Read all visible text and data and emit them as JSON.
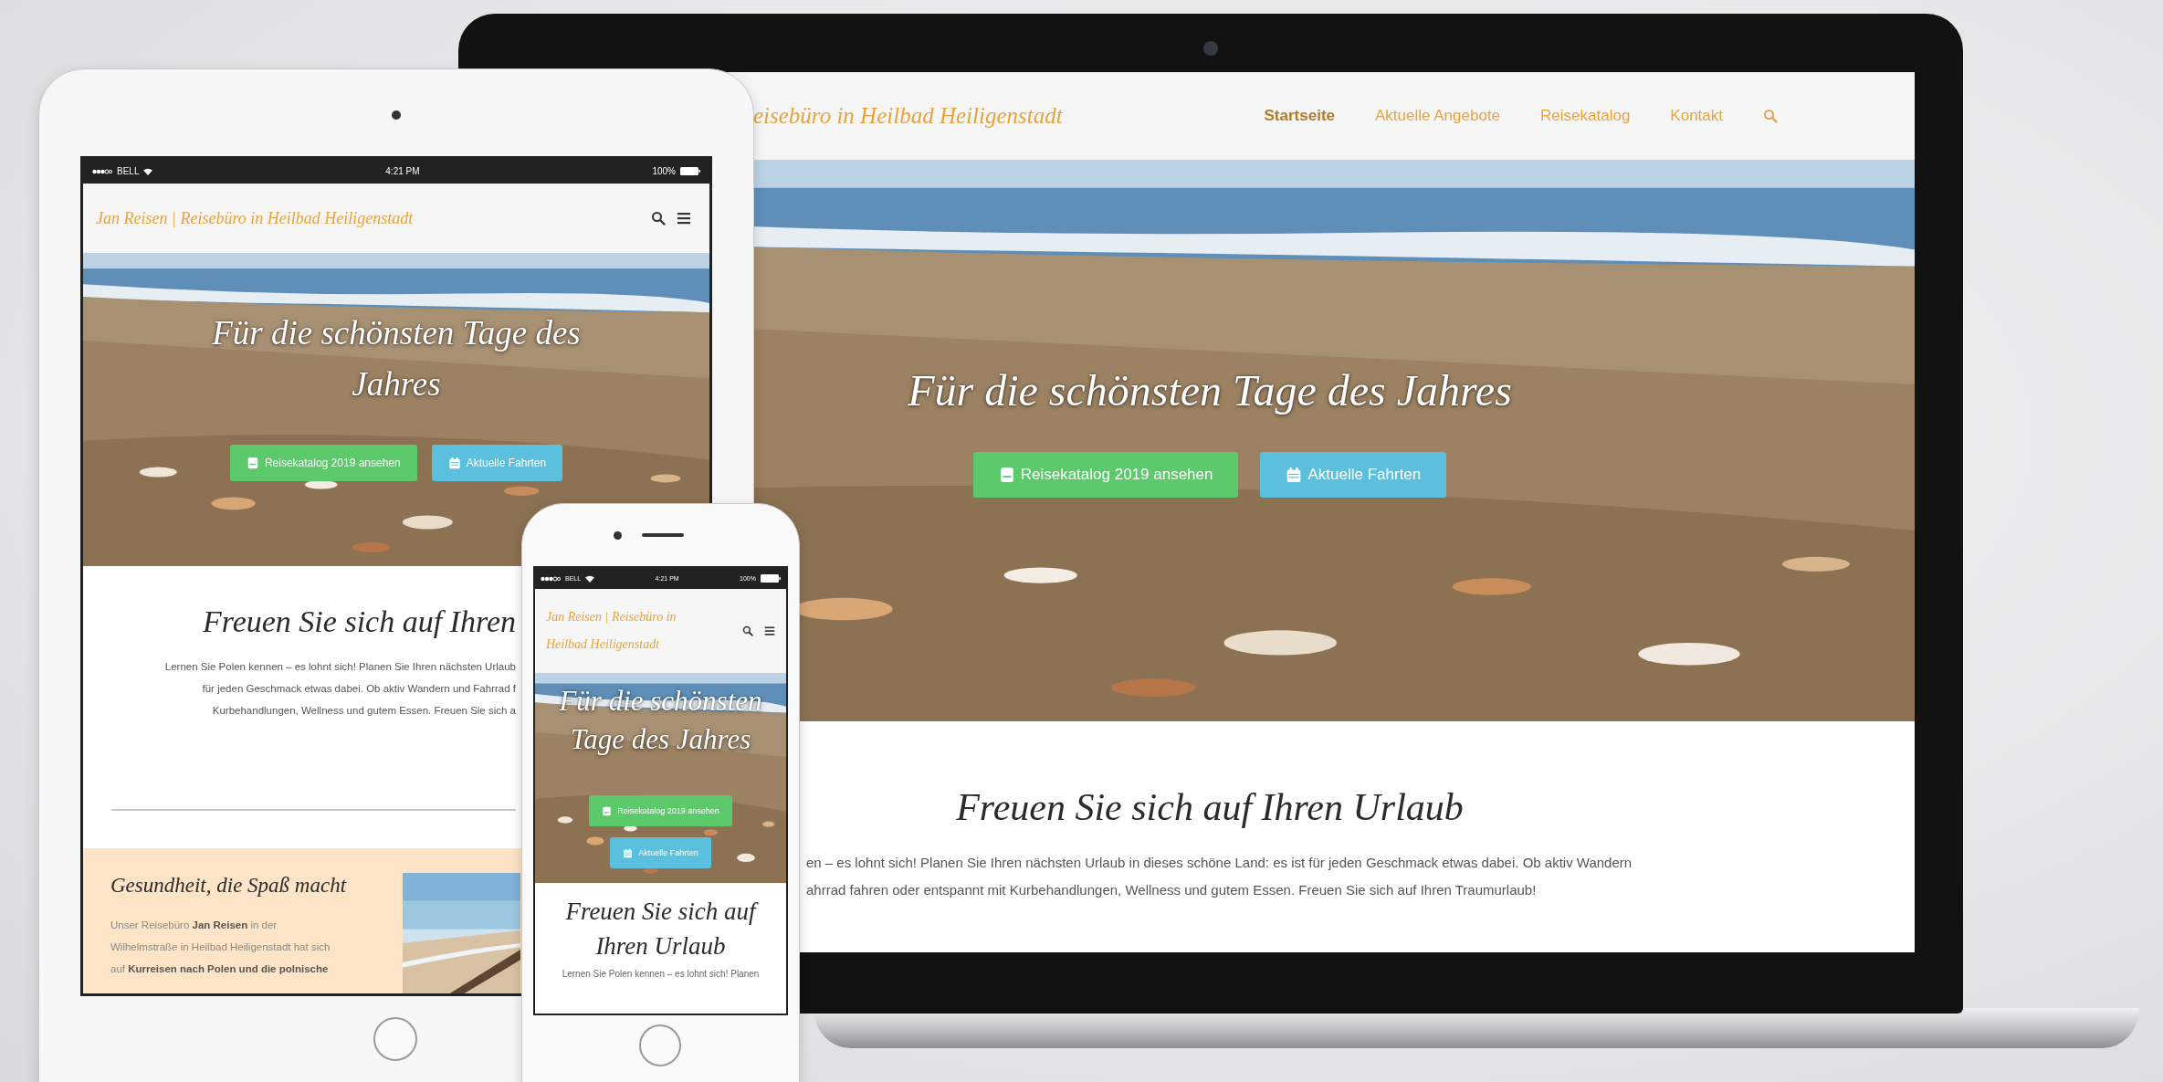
{
  "laptop": {
    "nav": {
      "logo": "eisebüro in Heilbad Heiligenstadt",
      "items": [
        {
          "label": "Startseite",
          "selected": true
        },
        {
          "label": "Aktuelle Angebote",
          "selected": false
        },
        {
          "label": "Reisekatalog",
          "selected": false
        },
        {
          "label": "Kontakt",
          "selected": false
        }
      ]
    },
    "hero": {
      "title": "Für die schönsten Tage des Jahres",
      "buttons": [
        {
          "label": "Reisekatalog 2019 ansehen",
          "kind": "catalog"
        },
        {
          "label": "Aktuelle Fahrten",
          "kind": "trips"
        }
      ]
    },
    "section": {
      "heading": "Freuen Sie sich auf Ihren Urlaub",
      "lines": [
        "en – es lohnt sich! Planen Sie Ihren nächsten Urlaub in dieses schöne Land: es ist für jeden Geschmack etwas dabei. Ob aktiv Wandern",
        "ahrrad fahren oder entspannt mit Kurbehandlungen, Wellness und gutem Essen. Freuen Sie sich auf Ihren Traumurlaub!"
      ]
    }
  },
  "tablet": {
    "status_bar": {
      "carrier": "BELL",
      "time": "4:21 PM",
      "battery": "100%"
    },
    "header": {
      "logo": "Jan Reisen | Reisebüro in Heilbad Heiligenstadt"
    },
    "hero": {
      "title": "Für die schönsten Tage des Jahres",
      "buttons": [
        {
          "label": "Reisekatalog 2019 ansehen",
          "kind": "catalog"
        },
        {
          "label": "Aktuelle Fahrten",
          "kind": "trips"
        }
      ]
    },
    "section": {
      "heading": "Freuen Sie sich auf Ihren",
      "lines": [
        "Lernen Sie Polen kennen – es lohnt sich! Planen Sie Ihren nächsten Urlaub",
        "für jeden Geschmack etwas dabei. Ob aktiv Wandern und Fahrrad f",
        "Kurbehandlungen, Wellness und gutem Essen. Freuen Sie sich a"
      ]
    },
    "feature": {
      "heading": "Gesundheit, die Spaß macht",
      "lines": [
        "Unser Reisebüro **Jan Reisen** in der",
        "Wilhelmstraße in Heilbad Heiligenstadt hat sich",
        "auf **Kurreisen nach Polen und die polnische**"
      ]
    }
  },
  "phone": {
    "status_bar": {
      "carrier": "BELL",
      "time": "4:21 PM",
      "battery": "100%"
    },
    "header": {
      "logo": "Jan Reisen | Reisebüro in Heilbad Heiligenstadt"
    },
    "hero": {
      "title": "Für die schönsten Tage des Jahres",
      "buttons": [
        {
          "label": "Reisekatalog 2019 ansehen",
          "kind": "catalog"
        },
        {
          "label": "Aktuelle Fahrten",
          "kind": "trips"
        }
      ]
    },
    "section": {
      "heading": "Freuen Sie sich auf Ihren Urlaub",
      "lines": [
        "Lernen Sie Polen kennen – es lohnt sich! Planen"
      ]
    }
  }
}
